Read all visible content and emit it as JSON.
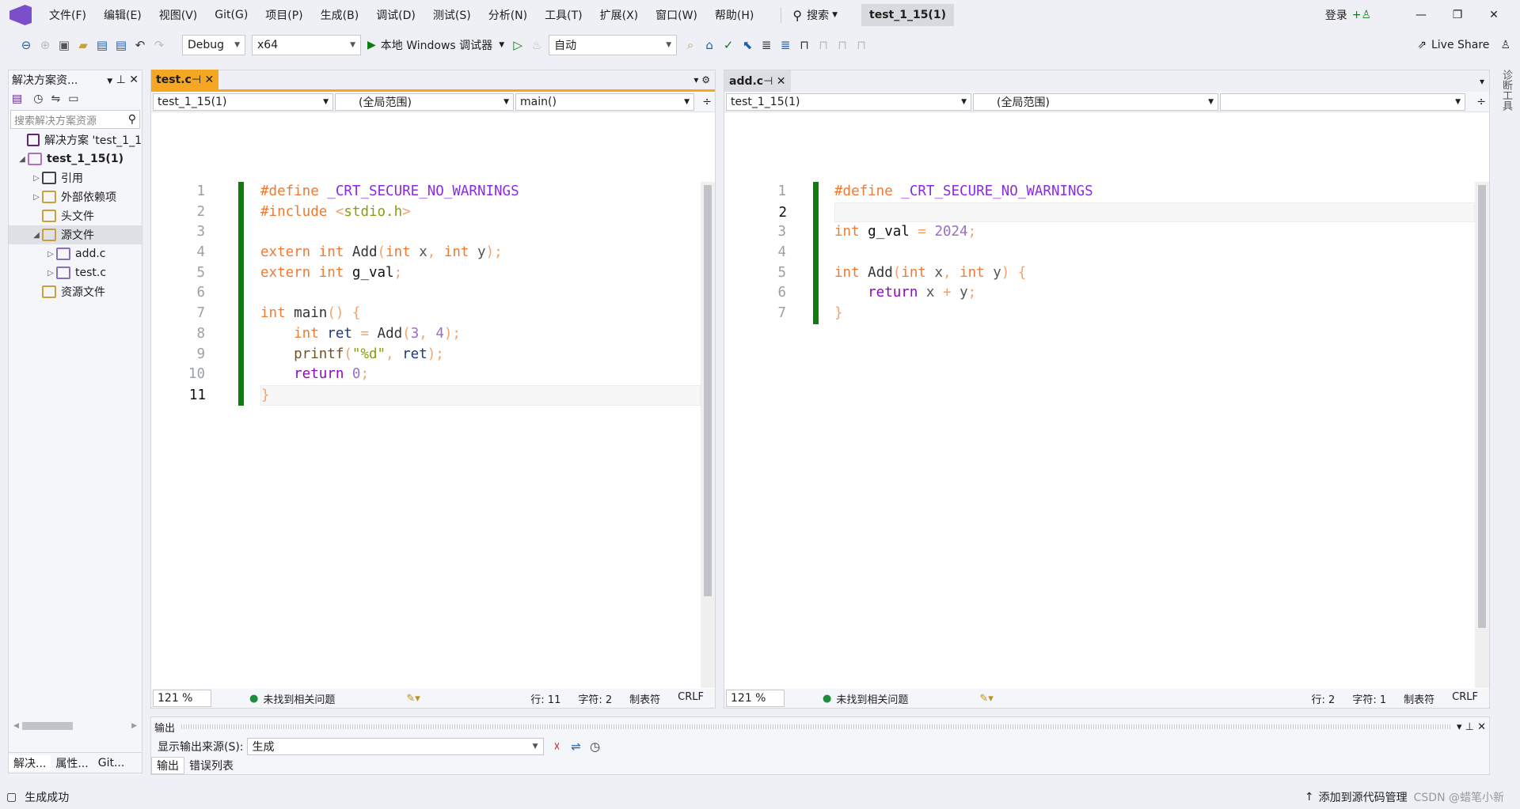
{
  "menu": [
    "文件(F)",
    "编辑(E)",
    "视图(V)",
    "Git(G)",
    "项目(P)",
    "生成(B)",
    "调试(D)",
    "测试(S)",
    "分析(N)",
    "工具(T)",
    "扩展(X)",
    "窗口(W)",
    "帮助(H)"
  ],
  "search_label": "搜索",
  "solution_name_badge": "test_1_15(1)",
  "login": "登录",
  "toolbar": {
    "config": "Debug",
    "platform": "x64",
    "run_label": "本地 Windows 调试器",
    "auto": "自动",
    "live_share": "Live Share"
  },
  "solution_explorer": {
    "title": "解决方案资...",
    "search_placeholder": "搜索解决方案资源",
    "items": [
      {
        "label": "解决方案 'test_1_1",
        "level": 0,
        "arrow": "",
        "icon": "solution-icon"
      },
      {
        "label": "test_1_15(1)",
        "level": 0,
        "arrow": "◢",
        "icon": "project-icon",
        "bold": true
      },
      {
        "label": "引用",
        "level": 1,
        "arrow": "▷",
        "icon": "references-icon"
      },
      {
        "label": "外部依赖项",
        "level": 1,
        "arrow": "▷",
        "icon": "folder-icon"
      },
      {
        "label": "头文件",
        "level": 1,
        "arrow": "",
        "icon": "filter-folder-icon"
      },
      {
        "label": "源文件",
        "level": 1,
        "arrow": "◢",
        "icon": "filter-folder-icon",
        "selected": true
      },
      {
        "label": "add.c",
        "level": 2,
        "arrow": "▷",
        "icon": "c-file-icon"
      },
      {
        "label": "test.c",
        "level": 2,
        "arrow": "▷",
        "icon": "c-file-icon"
      },
      {
        "label": "资源文件",
        "level": 1,
        "arrow": "",
        "icon": "filter-folder-icon"
      }
    ],
    "bottom_tabs": [
      "解决...",
      "属性...",
      "Git..."
    ]
  },
  "editors": [
    {
      "tab": "test.c",
      "active": true,
      "nav": [
        "test_1_15(1)",
        "(全局范围)",
        "main()"
      ],
      "current_line": 11,
      "lines": [
        [
          [
            "#define ",
            "k"
          ],
          [
            "_CRT_SECURE_NO_WARNINGS",
            "m"
          ]
        ],
        [
          [
            "#include ",
            "k"
          ],
          [
            "<",
            "o"
          ],
          [
            "stdio.h",
            "s"
          ],
          [
            ">",
            "o"
          ]
        ],
        [],
        [
          [
            "extern int ",
            "k"
          ],
          [
            "Add",
            "f"
          ],
          [
            "(",
            "o"
          ],
          [
            "int ",
            "k"
          ],
          [
            "x",
            "p"
          ],
          [
            ", ",
            "o"
          ],
          [
            "int ",
            "k"
          ],
          [
            "y",
            "p"
          ],
          [
            ");",
            "o"
          ]
        ],
        [
          [
            "extern int ",
            "k"
          ],
          [
            "g_val",
            "g"
          ],
          [
            ";",
            "o"
          ]
        ],
        [],
        [
          [
            "int ",
            "k"
          ],
          [
            "main",
            "f"
          ],
          [
            "() {",
            "o"
          ]
        ],
        [
          [
            "    int ",
            "k"
          ],
          [
            "ret ",
            "v"
          ],
          [
            "= ",
            "o"
          ],
          [
            "Add",
            "f"
          ],
          [
            "(",
            "o"
          ],
          [
            "3",
            "n"
          ],
          [
            ", ",
            "o"
          ],
          [
            "4",
            "n"
          ],
          [
            ");",
            "o"
          ]
        ],
        [
          [
            "    printf",
            "pf"
          ],
          [
            "(",
            "o"
          ],
          [
            "\"%d\"",
            "s"
          ],
          [
            ", ",
            "o"
          ],
          [
            "ret",
            "v"
          ],
          [
            ");",
            "o"
          ]
        ],
        [
          [
            "    return ",
            "r"
          ],
          [
            "0",
            "n"
          ],
          [
            ";",
            "o"
          ]
        ],
        [
          [
            "}",
            "o"
          ]
        ]
      ],
      "status": {
        "zoom": "121 %",
        "issues": "未找到相关问题",
        "line": "行: 11",
        "char": "字符: 2",
        "tab": "制表符",
        "eol": "CRLF"
      }
    },
    {
      "tab": "add.c",
      "active": false,
      "nav": [
        "test_1_15(1)",
        "(全局范围)",
        ""
      ],
      "current_line": 2,
      "lines": [
        [
          [
            "#define ",
            "k"
          ],
          [
            "_CRT_SECURE_NO_WARNINGS",
            "m"
          ]
        ],
        [],
        [
          [
            "int ",
            "k"
          ],
          [
            "g_val ",
            "g"
          ],
          [
            "= ",
            "o"
          ],
          [
            "2024",
            "n"
          ],
          [
            ";",
            "o"
          ]
        ],
        [],
        [
          [
            "int ",
            "k"
          ],
          [
            "Add",
            "f"
          ],
          [
            "(",
            "o"
          ],
          [
            "int ",
            "k"
          ],
          [
            "x",
            "p"
          ],
          [
            ", ",
            "o"
          ],
          [
            "int ",
            "k"
          ],
          [
            "y",
            "p"
          ],
          [
            ") {",
            "o"
          ]
        ],
        [
          [
            "    return ",
            "r"
          ],
          [
            "x ",
            "p"
          ],
          [
            "+ ",
            "o"
          ],
          [
            "y",
            "p"
          ],
          [
            ";",
            "o"
          ]
        ],
        [
          [
            "}",
            "o"
          ]
        ]
      ],
      "status": {
        "zoom": "121 %",
        "issues": "未找到相关问题",
        "line": "行: 2",
        "char": "字符: 1",
        "tab": "制表符",
        "eol": "CRLF"
      }
    }
  ],
  "side_panel": "诊断工具",
  "output": {
    "title": "输出",
    "source_label": "显示输出来源(S):",
    "source": "生成",
    "tabs": [
      "输出",
      "错误列表"
    ]
  },
  "statusbar": {
    "message": "生成成功",
    "scm": "添加到源代码管理",
    "watermark": "CSDN @蜡笔小新"
  },
  "colors": {
    "accent": "#f5a623",
    "change_bar": "#107c10",
    "vs_purple": "#68217a"
  }
}
